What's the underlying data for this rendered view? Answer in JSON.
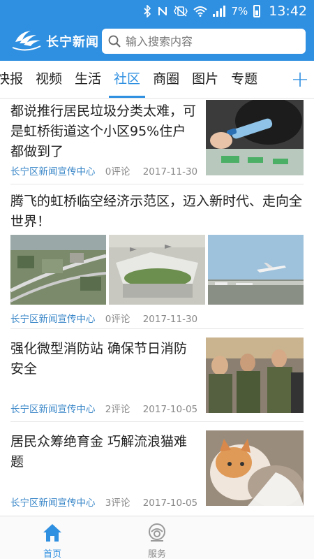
{
  "status_bar": {
    "battery": "7%",
    "time": "13:42",
    "icons": [
      "bluetooth-icon",
      "nfc-icon",
      "vibrate-icon",
      "wifi-icon",
      "signal-icon",
      "battery-charging-icon"
    ]
  },
  "header": {
    "app_title": "长宁新闻",
    "search_placeholder": "输入搜索内容"
  },
  "tabs": [
    {
      "label": "快报"
    },
    {
      "label": "视频"
    },
    {
      "label": "生活"
    },
    {
      "label": "社区",
      "active": true
    },
    {
      "label": "商圈"
    },
    {
      "label": "图片"
    },
    {
      "label": "专题"
    }
  ],
  "add_tab_icon": "plus-icon",
  "articles": [
    {
      "title": "都说推行居民垃圾分类太难，可是虹桥街道这个小区95%住户都做到了",
      "source": "长宁区新闻宣传中心",
      "comments": "0评论",
      "date": "2017-11-30",
      "image": "bottle-in-recycling-bin"
    },
    {
      "title": "腾飞的虹桥临空经济示范区，迈入新时代、走向全世界！",
      "source": "长宁区新闻宣传中心",
      "comments": "0评论",
      "date": "2017-11-30",
      "images": [
        "aerial-city-view",
        "airport-terminal-render",
        "airplane-takeoff"
      ]
    },
    {
      "title": "强化微型消防站 确保节日消防安全",
      "source": "长宁区新闻宣传中心",
      "comments": "2评论",
      "date": "2017-10-05",
      "image": "fire-drill-crowd"
    },
    {
      "title": "居民众筹绝育金 巧解流浪猫难题",
      "source": "长宁区新闻宣传中心",
      "comments": "3评论",
      "date": "2017-10-05",
      "image": "stray-cat"
    }
  ],
  "bottom_nav": [
    {
      "label": "首页",
      "icon": "home-icon",
      "active": true
    },
    {
      "label": "服务",
      "icon": "service-icon",
      "active": false
    }
  ],
  "colors": {
    "primary": "#2f8fe0",
    "source_text": "#3a87c8",
    "meta_text": "#888888"
  }
}
